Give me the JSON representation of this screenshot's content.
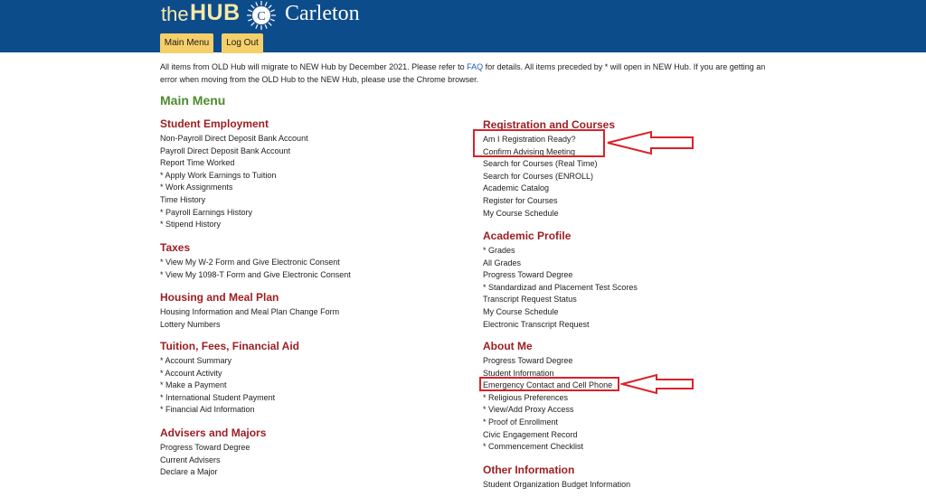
{
  "brand": {
    "the": "the",
    "hub": "HUB",
    "seal_letter": "C",
    "name": "Carleton"
  },
  "colors": {
    "header_bg": "#0d4c8b",
    "tab_bg": "#f5d06a",
    "section_heading": "#9c1f23",
    "page_title": "#4f8a2f",
    "link": "#1a5fb4",
    "annotation": "#d9222a"
  },
  "nav": {
    "main_menu": "Main Menu",
    "log_out": "Log Out"
  },
  "notice": {
    "before_link": "All items from OLD Hub will migrate to NEW Hub by December 2021. Please refer to ",
    "link": "FAQ",
    "after_link": " for details. All items preceded by * will open in NEW Hub. If you are getting an error when moving from the OLD Hub to the NEW Hub, please use the Chrome browser."
  },
  "page_title": "Main Menu",
  "sections": {
    "student_employment": {
      "title": "Student Employment",
      "items": [
        "Non-Payroll Direct Deposit Bank Account",
        "Payroll Direct Deposit Bank Account",
        "Report Time Worked",
        "* Apply Work Earnings to Tuition",
        "* Work Assignments",
        "Time History",
        "* Payroll Earnings History",
        "* Stipend History"
      ]
    },
    "taxes": {
      "title": "Taxes",
      "items": [
        "* View My W-2 Form and Give Electronic Consent",
        "* View My 1098-T Form and Give Electronic Consent"
      ]
    },
    "housing": {
      "title": "Housing and Meal Plan",
      "items": [
        "Housing Information and Meal Plan Change Form",
        "Lottery Numbers"
      ]
    },
    "tuition": {
      "title": "Tuition, Fees, Financial Aid",
      "items": [
        "* Account Summary",
        "* Account Activity",
        "* Make a Payment",
        "* International Student Payment",
        "* Financial Aid Information"
      ]
    },
    "advisers": {
      "title": "Advisers and Majors",
      "items": [
        "Progress Toward Degree",
        "Current Advisers",
        "Declare a Major"
      ]
    },
    "registration": {
      "title": "Registration and Courses",
      "items": [
        "Am I Registration Ready?",
        "Confirm Advising Meeting",
        "Search for Courses (Real Time)",
        "Search for Courses (ENROLL)",
        "Academic Catalog",
        "Register for Courses",
        "My Course Schedule"
      ]
    },
    "academic_profile": {
      "title": "Academic Profile",
      "items": [
        "* Grades",
        "All Grades",
        "Progress Toward Degree",
        "* Standardizad and Placement Test Scores",
        "Transcript Request Status",
        "My Course Schedule",
        "Electronic Transcript Request"
      ]
    },
    "about_me": {
      "title": "About Me",
      "items": [
        "Progress Toward Degree",
        "Student Information",
        "Emergency Contact and Cell Phone",
        "* Religious Preferences",
        "* View/Add Proxy Access",
        "* Proof of Enrollment",
        "Civic Engagement Record",
        "* Commencement Checklist"
      ]
    },
    "other": {
      "title": "Other Information",
      "items": [
        "Student Organization Budget Information"
      ]
    }
  }
}
